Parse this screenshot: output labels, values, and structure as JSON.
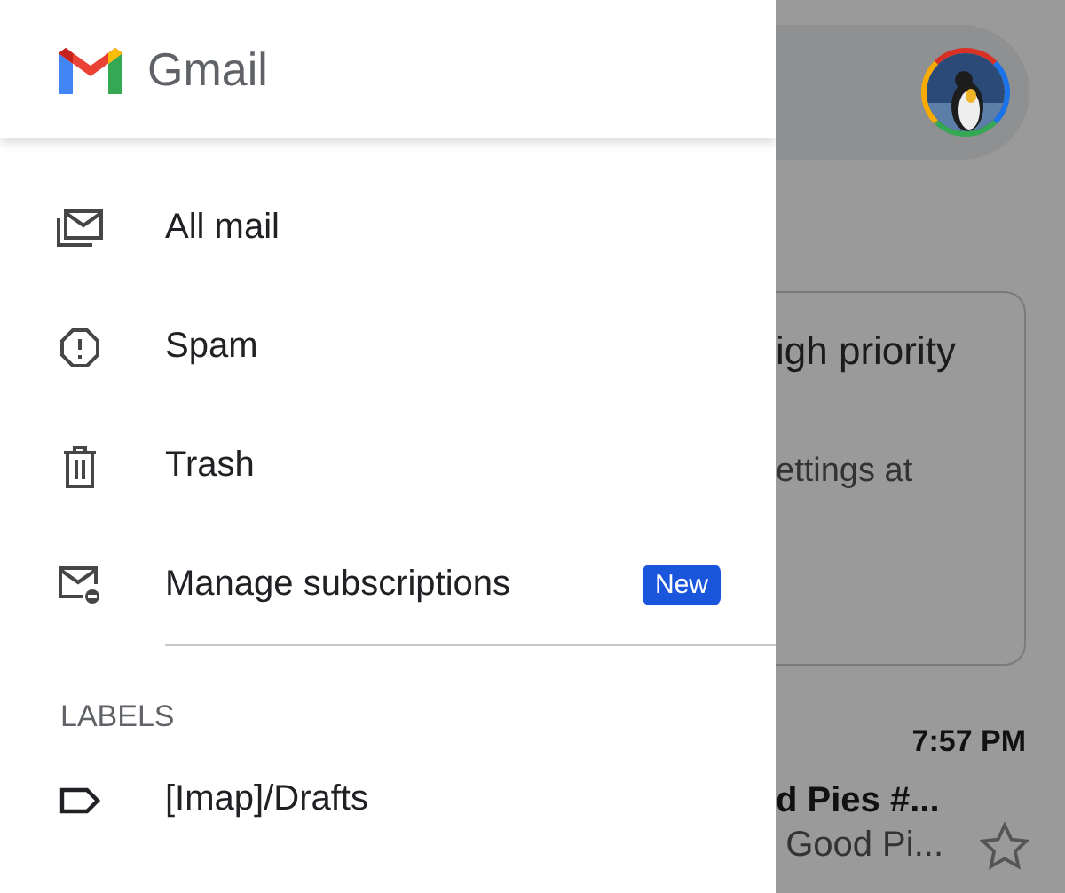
{
  "header": {
    "app_name": "Gmail"
  },
  "nav_items": [
    {
      "label": "All mail",
      "kind": "all-mail",
      "selected": false
    },
    {
      "label": "Spam",
      "kind": "spam",
      "selected": false
    },
    {
      "label": "Trash",
      "kind": "trash",
      "selected": false
    },
    {
      "label": "Manage subscriptions",
      "kind": "subscriptions",
      "selected": false,
      "badge": "New"
    }
  ],
  "labels_section": {
    "heading": "LABELS",
    "items": [
      {
        "label": "[Imap]/Drafts",
        "selected": false
      }
    ]
  },
  "background": {
    "card": {
      "title": "igh priority",
      "text": "ettings at"
    },
    "email": {
      "time": "7:57 PM",
      "sender": "d Pies #...",
      "preview": "Good Pi...",
      "starred": false
    }
  }
}
